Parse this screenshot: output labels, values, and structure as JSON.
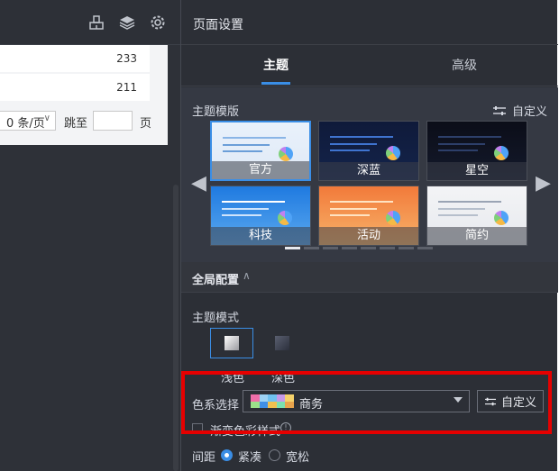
{
  "left_page": {
    "values": [
      "233",
      "211"
    ],
    "page_size_label": "0 条/页",
    "jump_label": "跳至",
    "page_suffix": "页"
  },
  "panel": {
    "title": "页面设置",
    "tabs": [
      {
        "label": "主题",
        "active": true
      },
      {
        "label": "高级",
        "active": false
      }
    ],
    "theme_templates": {
      "label": "主题模版",
      "custom_label": "自定义",
      "items": [
        {
          "name": "官方"
        },
        {
          "name": "深蓝"
        },
        {
          "name": "星空"
        },
        {
          "name": "科技"
        },
        {
          "name": "活动"
        },
        {
          "name": "简约"
        }
      ],
      "page_count": 8,
      "current_page": 1
    },
    "global_config": {
      "label": "全局配置",
      "theme_mode_label": "主题模式",
      "modes": [
        {
          "label": "浅色",
          "selected": true
        },
        {
          "label": "深色",
          "selected": false
        }
      ],
      "palette_label": "色系选择",
      "palette_value": "商务",
      "palette_colors": [
        "#f06ea9",
        "#9dd3f5",
        "#6fc1f0",
        "#c79ae8",
        "#f5d26b",
        "#9be08a",
        "#3f8fe6",
        "#f0c050",
        "#7be0b0",
        "#e8a34c"
      ],
      "palette_custom_label": "自定义",
      "gradient_label": "渐变色彩样式",
      "spacing_label": "间距",
      "spacing_options": [
        {
          "label": "紧凑",
          "selected": true
        },
        {
          "label": "宽松",
          "selected": false
        }
      ]
    }
  },
  "colors": {
    "accent": "#3a8ee6",
    "panel_bg": "#2c2f36",
    "highlight": "#e60000"
  }
}
